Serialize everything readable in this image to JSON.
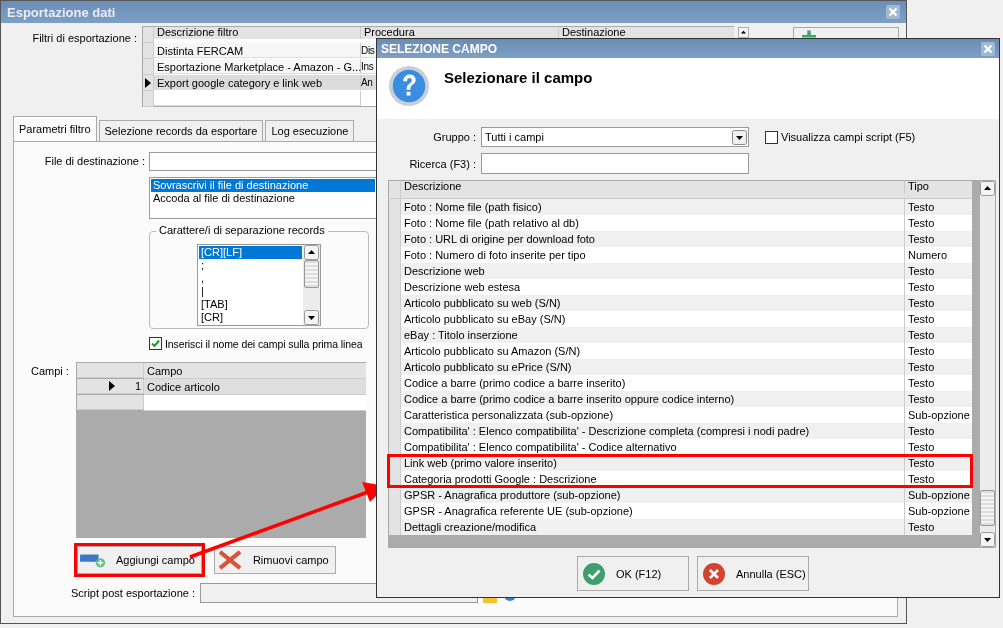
{
  "window": {
    "title": "Esportazione dati"
  },
  "filters": {
    "label": "Filtri di esportazione :",
    "columns": [
      "Descrizione filtro",
      "Procedura",
      "Destinazione"
    ],
    "rows": [
      {
        "description": "Distinta FERCAM",
        "procedure": "Dis",
        "selected": false
      },
      {
        "description": "Esportazione Marketplace - Amazon - G...",
        "procedure": "Ins",
        "selected": false
      },
      {
        "description": "Export google category e link web",
        "procedure": "An",
        "selected": true
      }
    ]
  },
  "tabs": [
    {
      "label": "Parametri filtro",
      "selected": true
    },
    {
      "label": "Selezione records da esportare",
      "selected": false
    },
    {
      "label": "Log esecuzione",
      "selected": false
    }
  ],
  "destination": {
    "label": "File di destinazione :"
  },
  "write_modes": [
    {
      "label": "Sovrascrivi il file di destinazione",
      "selected": true
    },
    {
      "label": "Accoda al file di destinazione",
      "selected": false
    }
  ],
  "separator": {
    "legend": "Carattere/i di separazione records",
    "options": [
      {
        "label": "[CR][LF]",
        "selected": true
      },
      {
        "label": ";",
        "selected": false
      },
      {
        "label": ",",
        "selected": false
      },
      {
        "label": "|",
        "selected": false
      },
      {
        "label": "[TAB]",
        "selected": false
      },
      {
        "label": "[CR]",
        "selected": false
      }
    ]
  },
  "header_row": {
    "label": "Inserisci il nome dei campi sulla prima linea",
    "checked": true
  },
  "fields": {
    "label": "Campi :",
    "column": "Campo",
    "rows": [
      {
        "number": "1",
        "name": "Codice articolo",
        "selected": true
      }
    ]
  },
  "buttons": [
    {
      "label": "Aggiungi campo",
      "kind": "add",
      "highlighted": true
    },
    {
      "label": "Rimuovi campo",
      "kind": "remove",
      "highlighted": false
    }
  ],
  "script": {
    "label": "Script post esportazione :"
  },
  "dialog": {
    "title": "SELEZIONE CAMPO",
    "heading": "Selezionare il campo",
    "group": {
      "label": "Gruppo :",
      "value": "Tutti i campi"
    },
    "show_script": {
      "label": "Visualizza campi script (F5)",
      "checked": false
    },
    "search": {
      "label": "Ricerca (F3) :"
    },
    "columns": [
      "Descrizione",
      "Tipo"
    ],
    "rows": [
      {
        "description": "Foto : Nome file (path fisico)",
        "type": "Testo",
        "highlighted": false
      },
      {
        "description": "Foto : Nome file (path relativo al db)",
        "type": "Testo",
        "highlighted": false
      },
      {
        "description": "Foto : URL di origine per download foto",
        "type": "Testo",
        "highlighted": false
      },
      {
        "description": "Foto : Numero di foto inserite per tipo",
        "type": "Numero",
        "highlighted": false
      },
      {
        "description": "Descrizione web",
        "type": "Testo",
        "highlighted": false
      },
      {
        "description": "Descrizione web estesa",
        "type": "Testo",
        "highlighted": false
      },
      {
        "description": "Articolo pubblicato su web (S/N)",
        "type": "Testo",
        "highlighted": false
      },
      {
        "description": "Articolo pubblicato su eBay (S/N)",
        "type": "Testo",
        "highlighted": false
      },
      {
        "description": "eBay : Titolo inserzione",
        "type": "Testo",
        "highlighted": false
      },
      {
        "description": "Articolo pubblicato su Amazon (S/N)",
        "type": "Testo",
        "highlighted": false
      },
      {
        "description": "Articolo pubblicato su ePrice (S/N)",
        "type": "Testo",
        "highlighted": false
      },
      {
        "description": "Codice a barre (primo codice a barre inserito)",
        "type": "Testo",
        "highlighted": false
      },
      {
        "description": "Codice a barre (primo codice a barre inserito oppure codice interno)",
        "type": "Testo",
        "highlighted": false
      },
      {
        "description": "Caratteristica personalizzata (sub-opzione)",
        "type": "Sub-opzione",
        "highlighted": false
      },
      {
        "description": "Compatibilita' : Elenco compatibilita' - Descrizione completa (compresi i nodi padre)",
        "type": "Testo",
        "highlighted": false
      },
      {
        "description": "Compatibilita' : Elenco compatibilita' - Codice alternativo",
        "type": "Testo",
        "highlighted": false
      },
      {
        "description": "Link web (primo valore inserito)",
        "type": "Testo",
        "highlighted": true
      },
      {
        "description": "Categoria prodotti Google : Descrizione",
        "type": "Testo",
        "highlighted": true
      },
      {
        "description": "GPSR - Anagrafica produttore (sub-opzione)",
        "type": "Sub-opzione",
        "highlighted": false
      },
      {
        "description": "GPSR - Anagrafica referente UE (sub-opzione)",
        "type": "Sub-opzione",
        "highlighted": false
      },
      {
        "description": "Dettagli creazione/modifica",
        "type": "Testo",
        "highlighted": false
      }
    ],
    "buttons": [
      {
        "label": "OK (F12)",
        "kind": "ok"
      },
      {
        "label": "Annulla (ESC)",
        "kind": "cancel"
      }
    ]
  }
}
